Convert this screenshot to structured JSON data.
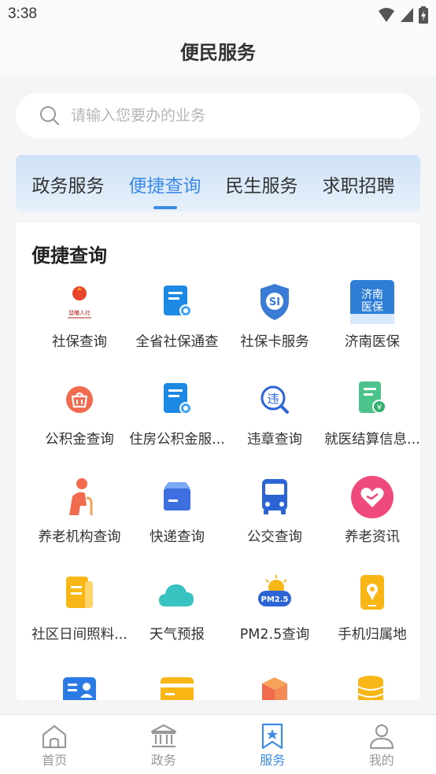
{
  "status_bar": {
    "time": "3:38"
  },
  "header": {
    "title": "便民服务"
  },
  "search": {
    "placeholder": "请输入您要办的业务"
  },
  "tabs": [
    {
      "label": "政务服务"
    },
    {
      "label": "便捷查询",
      "active": true
    },
    {
      "label": "民生服务"
    },
    {
      "label": "求职招聘"
    }
  ],
  "panel": {
    "title": "便捷查询",
    "items": [
      {
        "label": "社保查询",
        "icon": "social-security-logo-icon",
        "icon_text": "鼠曦人社"
      },
      {
        "label": "全省社保通查",
        "icon": "certificate-document-icon"
      },
      {
        "label": "社保卡服务",
        "icon": "social-security-card-shield-icon"
      },
      {
        "label": "济南医保",
        "icon": "jinan-medical-insurance-icon",
        "icon_text": "济南医保"
      },
      {
        "label": "公积金查询",
        "icon": "housing-fund-basket-icon"
      },
      {
        "label": "住房公积金服...",
        "icon": "certificate-document-icon"
      },
      {
        "label": "违章查询",
        "icon": "traffic-violation-search-icon",
        "icon_text": "违"
      },
      {
        "label": "就医结算信息...",
        "icon": "medical-bill-yuan-icon"
      },
      {
        "label": "养老机构查询",
        "icon": "elderly-person-icon"
      },
      {
        "label": "快递查询",
        "icon": "express-package-icon"
      },
      {
        "label": "公交查询",
        "icon": "bus-icon"
      },
      {
        "label": "养老资讯",
        "icon": "heart-care-icon"
      },
      {
        "label": "社区日间照料...",
        "icon": "community-care-document-icon"
      },
      {
        "label": "天气预报",
        "icon": "cloud-weather-icon"
      },
      {
        "label": "PM2.5查询",
        "icon": "pm25-sun-cloud-icon",
        "icon_text": "PM2.5"
      },
      {
        "label": "手机归属地",
        "icon": "mobile-location-icon"
      },
      {
        "label": "",
        "icon": "id-card-icon"
      },
      {
        "label": "",
        "icon": "bank-card-icon"
      },
      {
        "label": "",
        "icon": "box-icon"
      },
      {
        "label": "",
        "icon": "coin-stack-icon"
      }
    ]
  },
  "bottom_nav": [
    {
      "label": "首页",
      "icon": "home-icon"
    },
    {
      "label": "政务",
      "icon": "government-building-icon"
    },
    {
      "label": "服务",
      "icon": "service-bookmark-star-icon",
      "active": true
    },
    {
      "label": "我的",
      "icon": "user-profile-icon"
    }
  ],
  "colors": {
    "accent": "#3d8be6",
    "tab_gradient_top": "#cfe2f7",
    "background": "#f4f5f7"
  }
}
